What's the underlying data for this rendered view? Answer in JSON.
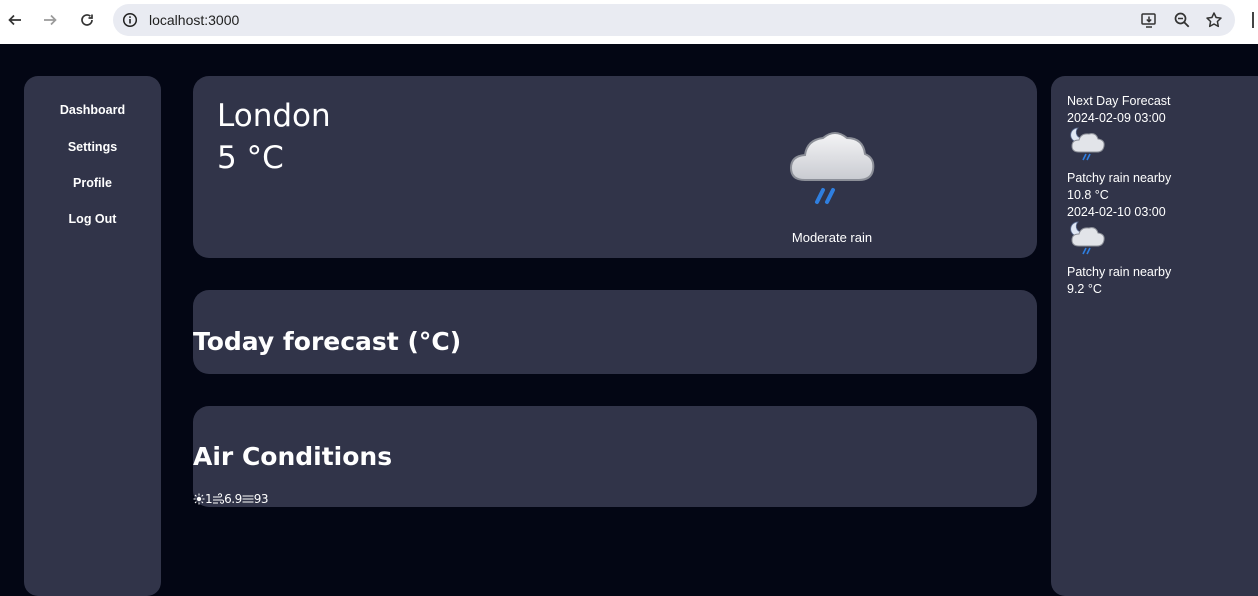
{
  "browser": {
    "url": "localhost:3000"
  },
  "sidebar": {
    "items": [
      {
        "label": "Dashboard"
      },
      {
        "label": "Settings"
      },
      {
        "label": "Profile"
      },
      {
        "label": "Log Out"
      }
    ]
  },
  "current": {
    "city": "London",
    "temperature": "5 °C",
    "condition": "Moderate rain",
    "icon": "rain-cloud-icon"
  },
  "today_forecast": {
    "title": "Today forecast (°C)"
  },
  "air_conditions": {
    "title": "Air Conditions",
    "uv": "1",
    "wind": "6.9",
    "humidity": "93",
    "icons": [
      "sun-icon",
      "wind-icon",
      "humidity-icon"
    ]
  },
  "next_day": {
    "title": "Next Day Forecast",
    "days": [
      {
        "datetime": "2024-02-09 03:00",
        "condition": "Patchy rain nearby",
        "temperature": "10.8 °C",
        "icon": "night-rain-icon"
      },
      {
        "datetime": "2024-02-10 03:00",
        "condition": "Patchy rain nearby",
        "temperature": "9.2 °C",
        "icon": "night-rain-icon"
      }
    ]
  },
  "colors": {
    "background": "#030614",
    "card": "#313449",
    "text": "#ffffff",
    "rain_accent": "#2f7fe0"
  }
}
